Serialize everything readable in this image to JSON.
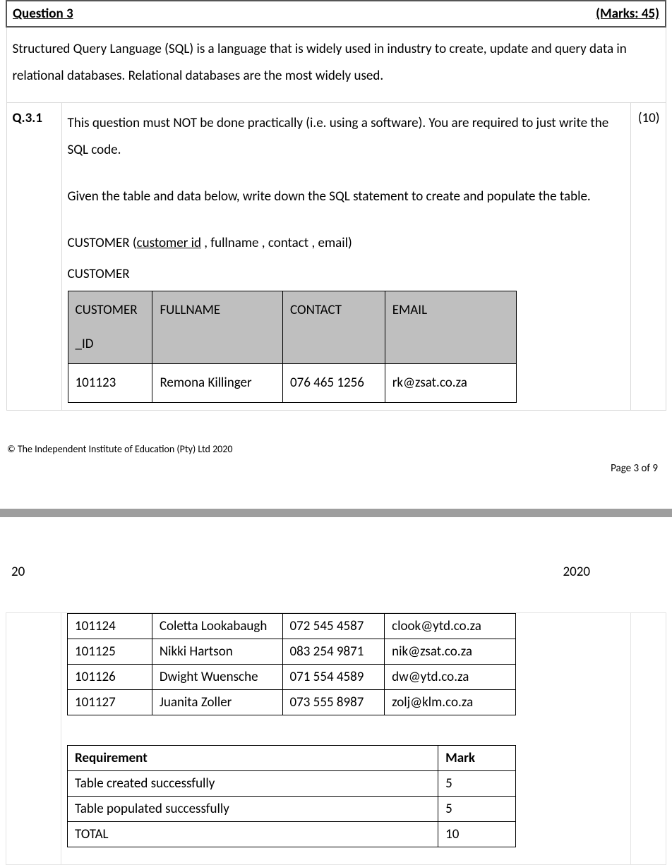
{
  "question": {
    "title": "Question 3",
    "marks_label": "(Marks: 45)",
    "intro": "Structured Query Language (SQL) is a language that is widely used in industry to create, update and query data in relational databases. Relational databases are the most widely used."
  },
  "sub": {
    "num": "Q.3.1",
    "points": "(10)",
    "para1a": "This question must NOT be done practically (i.e. using a software). You are required to just write the SQL code.",
    "para2": "Given the table and data below, write down the SQL statement to create and populate the table.",
    "schema_prefix": "CUSTOMER (",
    "schema_pk": "customer  id",
    "schema_rest": " ,  fullname , contact , email)",
    "table_label": "CUSTOMER"
  },
  "customer_headers": {
    "id_line1": "CUSTOMER",
    "id_line2": "_ID",
    "fullname": "FULLNAME",
    "contact": "CONTACT",
    "email": "EMAIL"
  },
  "customers_p1": [
    {
      "id": "101123",
      "fullname": "Remona Killinger",
      "contact": "076 465 1256",
      "email": "rk@zsat.co.za"
    }
  ],
  "footer1": {
    "copyright": "© The Independent Institute of Education (Pty) Ltd 2020",
    "page": "Page 3 of 9"
  },
  "header2": {
    "left": "20",
    "right": "2020"
  },
  "customers_p2": [
    {
      "id": "101124",
      "fullname": "Coletta Lookabaugh",
      "contact": "072 545 4587",
      "email": "clook@ytd.co.za"
    },
    {
      "id": "101125",
      "fullname": "Nikki Hartson",
      "contact": "083 254 9871",
      "email": "nik@zsat.co.za"
    },
    {
      "id": "101126",
      "fullname": "Dwight Wuensche",
      "contact": "071 554 4589",
      "email": "dw@ytd.co.za"
    },
    {
      "id": "101127",
      "fullname": "Juanita Zoller",
      "contact": "073 555 8987",
      "email": "zolj@klm.co.za"
    }
  ],
  "requirements": {
    "header_req": "Requirement",
    "header_mark": "Mark",
    "rows": [
      {
        "req": "Table created successfully",
        "mark": "5"
      },
      {
        "req": "Table populated successfully",
        "mark": "5"
      },
      {
        "req": "TOTAL",
        "mark": "10"
      }
    ]
  }
}
